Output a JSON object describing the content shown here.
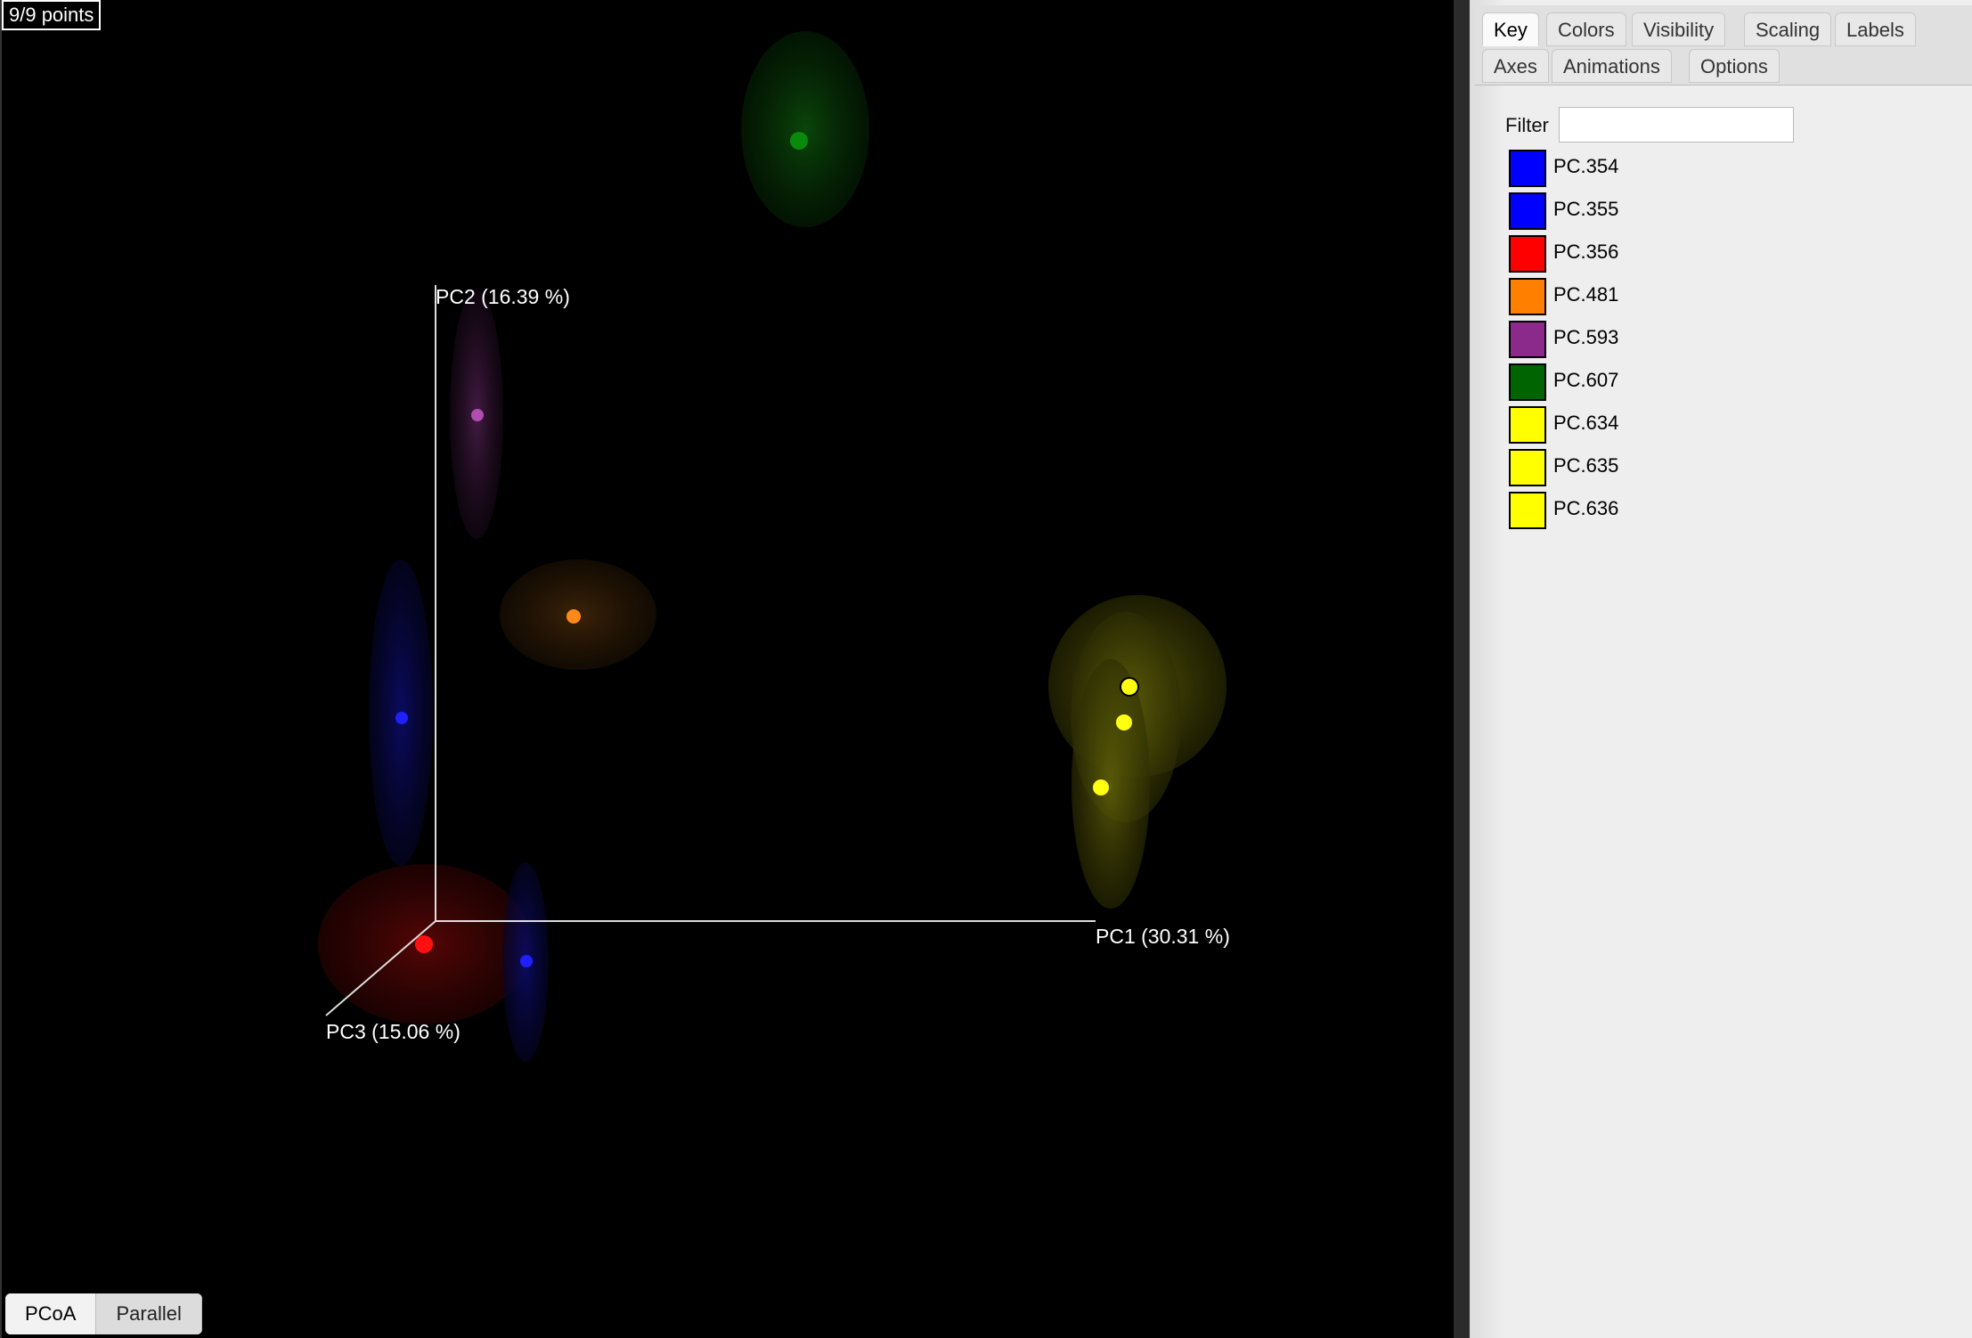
{
  "viewer": {
    "point_count": "9/9 points",
    "axes": {
      "pc1": "PC1 (30.31 %)",
      "pc2": "PC2 (16.39 %)",
      "pc3": "PC3 (15.06 %)"
    },
    "view_tabs": [
      {
        "label": "PCoA",
        "active": true
      },
      {
        "label": "Parallel",
        "active": false
      }
    ]
  },
  "panel": {
    "tabs": [
      {
        "label": "Key",
        "active": true
      },
      {
        "label": "Colors",
        "active": false
      },
      {
        "label": "Visibility",
        "active": false
      },
      {
        "label": "Scaling",
        "active": false
      },
      {
        "label": "Labels",
        "active": false
      },
      {
        "label": "Axes",
        "active": false
      },
      {
        "label": "Animations",
        "active": false
      },
      {
        "label": "Options",
        "active": false
      }
    ],
    "filter": {
      "label": "Filter",
      "value": "",
      "placeholder": ""
    },
    "key": [
      {
        "label": "PC.354",
        "color": "#0000ff"
      },
      {
        "label": "PC.355",
        "color": "#0000ff"
      },
      {
        "label": "PC.356",
        "color": "#ff0000"
      },
      {
        "label": "PC.481",
        "color": "#ff7f00"
      },
      {
        "label": "PC.593",
        "color": "#8b2a8b"
      },
      {
        "label": "PC.607",
        "color": "#006400"
      },
      {
        "label": "PC.634",
        "color": "#ffff00"
      },
      {
        "label": "PC.635",
        "color": "#ffff00"
      },
      {
        "label": "PC.636",
        "color": "#ffff00"
      }
    ]
  }
}
